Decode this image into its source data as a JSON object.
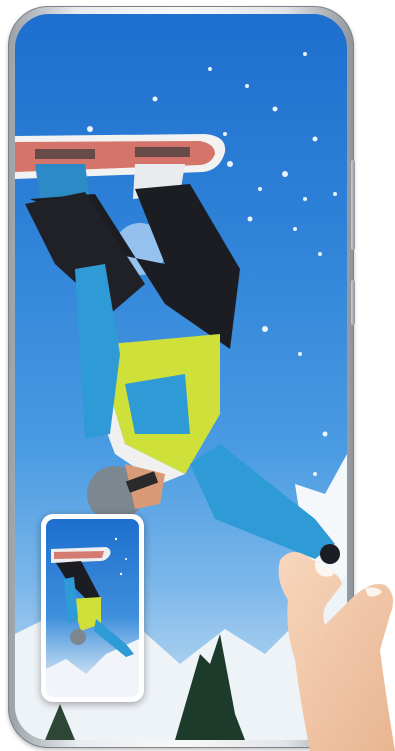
{
  "scene": {
    "device": "phone",
    "content": "snowboarder-photo",
    "floating_window": "thumbnail-preview",
    "gesture": "pinch-hand"
  },
  "colors": {
    "sky": "#2f82d8",
    "jacket": "#2f9bd6",
    "vest": "#cfe03a",
    "pants": "#1b1d22",
    "snow": "#ffffff",
    "skin": "#f3c9a8"
  }
}
